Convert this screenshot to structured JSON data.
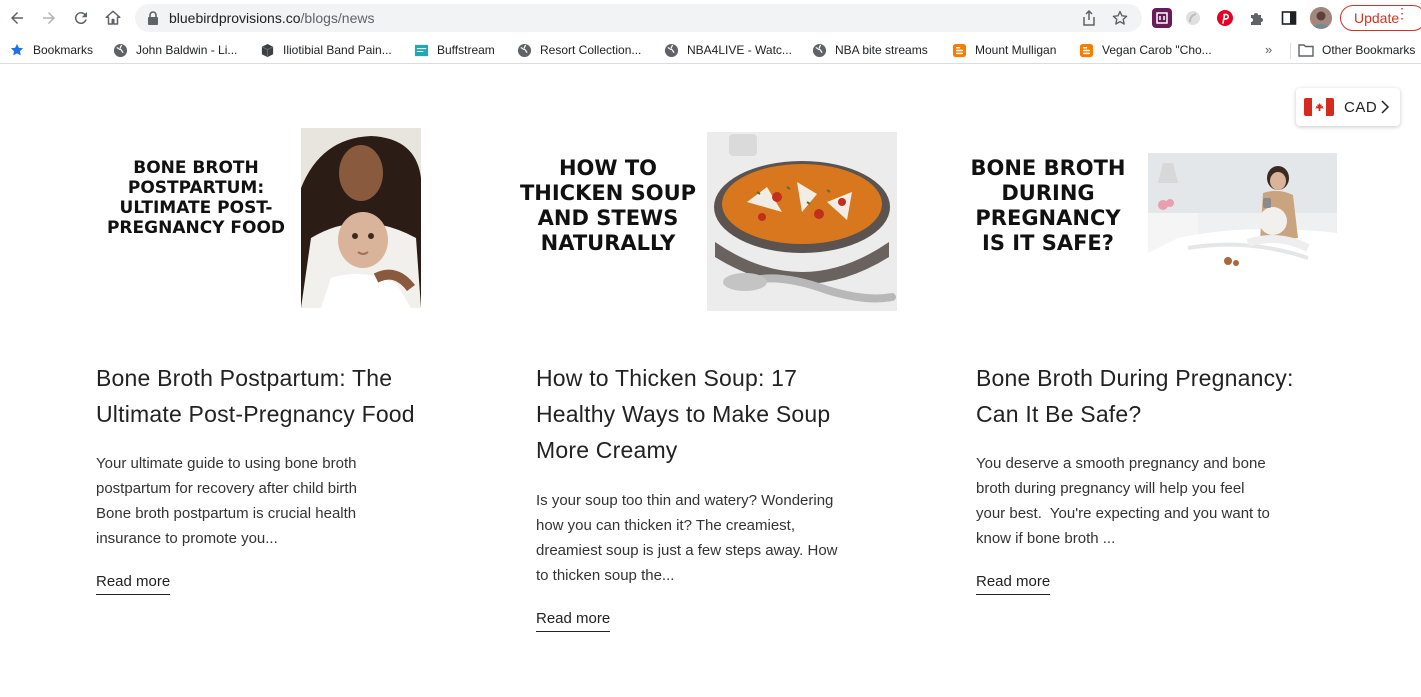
{
  "browser": {
    "url_host": "bluebirdprovisions.co",
    "url_path": "/blogs/news",
    "update_label": "Update"
  },
  "bookmarks": [
    {
      "label": "Bookmarks",
      "icon": "star-icon"
    },
    {
      "label": "John Baldwin - Li...",
      "icon": "globe-icon"
    },
    {
      "label": "Iliotibial Band Pain...",
      "icon": "cube-icon"
    },
    {
      "label": "Buffstream",
      "icon": "buffstream-icon"
    },
    {
      "label": "Resort Collection...",
      "icon": "globe-icon"
    },
    {
      "label": "NBA4LIVE - Watc...",
      "icon": "globe-icon"
    },
    {
      "label": "NBA bite streams",
      "icon": "globe-icon"
    },
    {
      "label": "Mount Mulligan",
      "icon": "blogger-icon"
    },
    {
      "label": "Vegan Carob \"Cho...",
      "icon": "blogger-icon"
    }
  ],
  "other_bookmarks": "Other Bookmarks",
  "currency": {
    "code": "CAD",
    "flag": "canada-flag-icon"
  },
  "posts": [
    {
      "image_text": [
        "BONE BROTH",
        "POSTPARTUM:",
        "ULTIMATE POST-",
        "PREGNANCY FOOD"
      ],
      "title_lines": [
        "Bone Broth Postpartum: The",
        "Ultimate Post-Pregnancy Food"
      ],
      "excerpt_lines": [
        "Your ultimate guide to using bone broth",
        "postpartum for recovery after child birth",
        "Bone broth postpartum is crucial health",
        "insurance to promote you..."
      ],
      "read_more": "Read more"
    },
    {
      "image_text": [
        "HOW TO",
        "THICKEN SOUP",
        "AND STEWS",
        "NATURALLY"
      ],
      "title_lines": [
        "How to Thicken Soup: 17",
        "Healthy Ways to Make Soup",
        "More Creamy"
      ],
      "excerpt_lines": [
        "Is your soup too thin and watery? Wondering",
        "how you can thicken it? The creamiest,",
        "dreamiest soup is just a few steps away. How",
        "to thicken soup the..."
      ],
      "read_more": "Read more"
    },
    {
      "image_text": [
        "BONE BROTH",
        "DURING",
        "PREGNANCY",
        "IS IT SAFE?"
      ],
      "title_lines": [
        "Bone Broth During Pregnancy:",
        "Can It Be Safe?"
      ],
      "excerpt_lines": [
        "You deserve a smooth pregnancy and bone",
        "broth during pregnancy will help you feel",
        "your best.  You're expecting and you want to",
        "know if bone broth ..."
      ],
      "read_more": "Read more"
    }
  ],
  "colors": {
    "update_red": "#d93025",
    "flag_red": "#d52b1e",
    "pinterest": "#e60023"
  }
}
